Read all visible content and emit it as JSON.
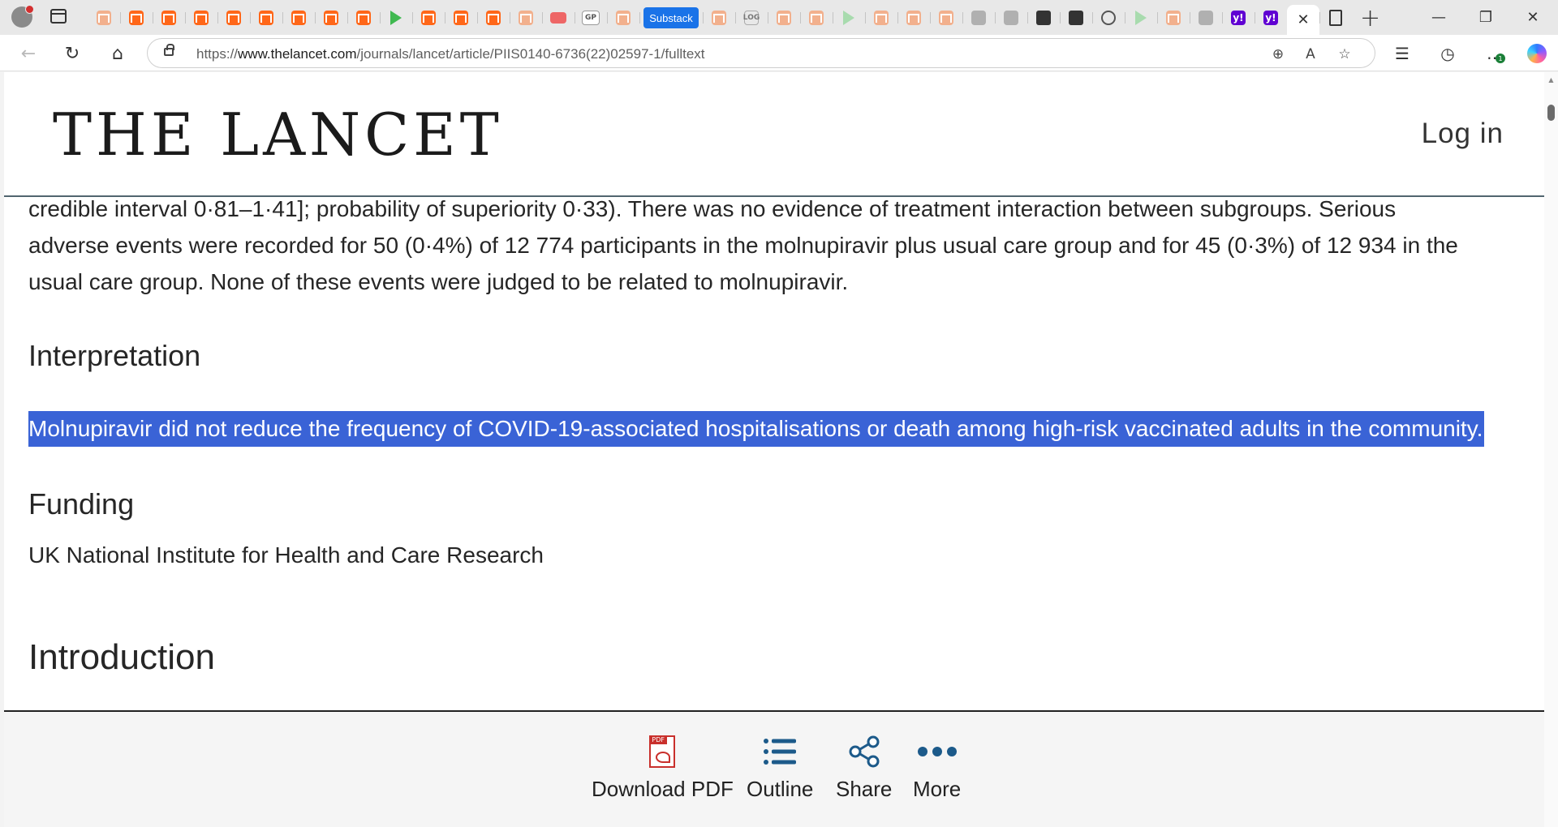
{
  "browser": {
    "tabs": {
      "substack_label": "Substack",
      "gp_label": "GP",
      "log_label": "LOG",
      "yahoo_label": "y!"
    },
    "window_controls": {
      "minimize": "—",
      "restore": "❐",
      "close": "✕"
    },
    "address_bar": {
      "url_prefix": "https://",
      "url_host": "www.thelancet.com",
      "url_path": "/journals/lancet/article/PIIS0140-6736(22)02597-1/fulltext"
    },
    "toolbar_badge": "1"
  },
  "header": {
    "logo": "THE LANCET",
    "login": "Log in"
  },
  "article": {
    "results_text": "credible interval 0·81–1·41]; probability of superiority 0·33). There was no evidence of treatment interaction between subgroups. Serious adverse events were recorded for 50 (0·4%) of 12 774 participants in the molnupiravir plus usual care group and for 45 (0·3%) of 12 934 in the usual care group. None of these events were judged to be related to molnupiravir.",
    "interpretation_heading": "Interpretation",
    "interpretation_text": "Molnupiravir did not reduce the frequency of COVID-19-associated hospitalisations or death among high-risk vaccinated adults in the community.",
    "funding_heading": "Funding",
    "funding_text": "UK National Institute for Health and Care Research",
    "introduction_heading": "Introduction"
  },
  "article_tools": {
    "download_pdf": "Download PDF",
    "pdf_tag": "PDF",
    "outline": "Outline",
    "share": "Share",
    "more": "More"
  },
  "colors": {
    "selection": "#3a63d6",
    "tool_icon": "#1c5a8a",
    "pdf_red": "#c9302c",
    "header_rule": "#51656f"
  }
}
